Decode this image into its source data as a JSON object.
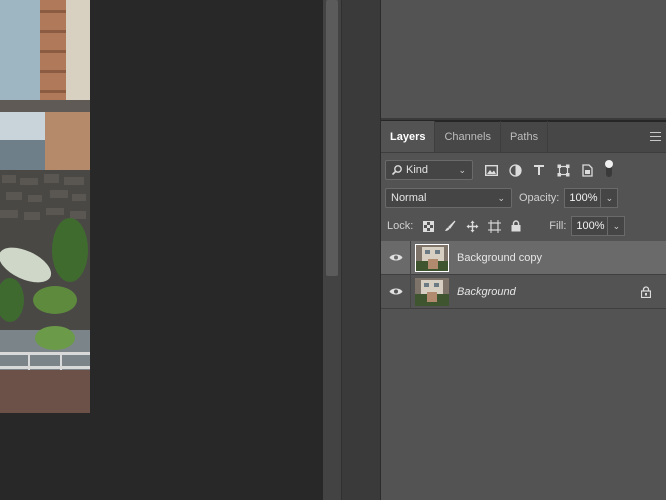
{
  "canvas": {
    "image_alt": "building photo"
  },
  "panel": {
    "tabs": [
      {
        "label": "Layers",
        "active": true
      },
      {
        "label": "Channels",
        "active": false
      },
      {
        "label": "Paths",
        "active": false
      }
    ],
    "filter": {
      "kind_label": "Kind"
    },
    "blend_mode": "Normal",
    "opacity_label": "Opacity:",
    "opacity_value": "100%",
    "lock_label": "Lock:",
    "fill_label": "Fill:",
    "fill_value": "100%",
    "layers": [
      {
        "name": "Background copy",
        "selected": true,
        "visible": true,
        "locked": false,
        "italic": false
      },
      {
        "name": "Background",
        "selected": false,
        "visible": true,
        "locked": true,
        "italic": true
      }
    ]
  },
  "colors": {
    "panel_bg": "#535353",
    "tab_bg": "#474747",
    "selected_layer": "#6a6a6a",
    "canvas_bg": "#282828"
  }
}
